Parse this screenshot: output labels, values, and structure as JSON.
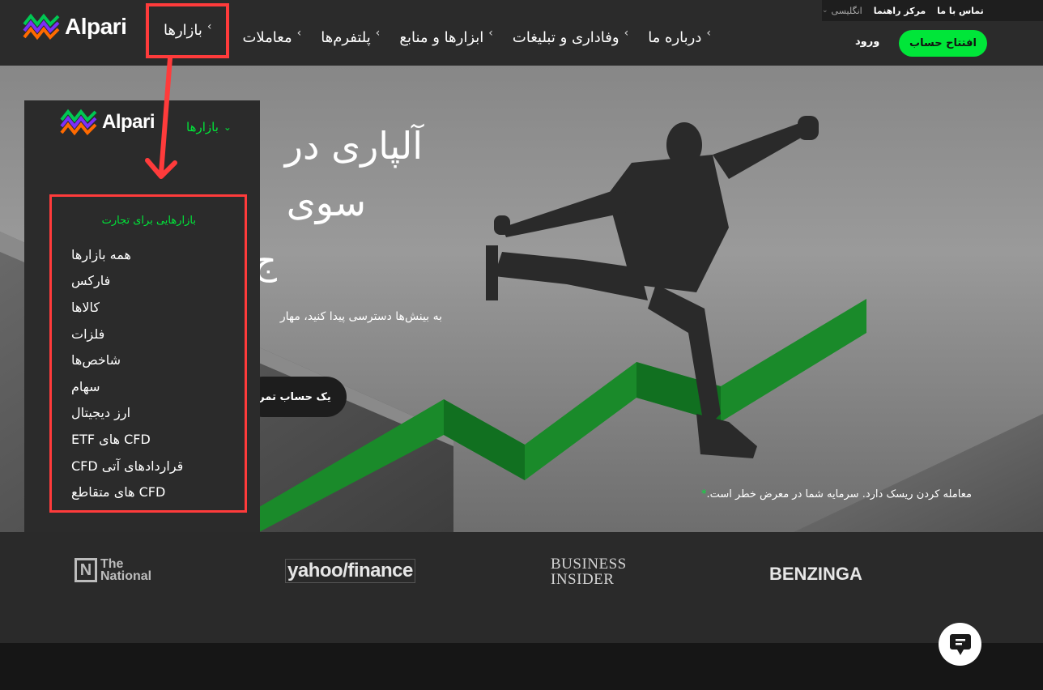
{
  "brand": {
    "name": "Alpari"
  },
  "utility": {
    "contact": "تماس با ما",
    "help_center": "مرکز راهنما",
    "language": "انگلیسی"
  },
  "nav": {
    "items": [
      {
        "label": "درباره ما"
      },
      {
        "label": "وفاداری و تبلیغات"
      },
      {
        "label": "ابزارها و منابع"
      },
      {
        "label": "پلتفرم‌ها"
      },
      {
        "label": "معاملات"
      },
      {
        "label": "بازارها"
      }
    ]
  },
  "header": {
    "login": "ورود",
    "open_account": "افتتاح حساب"
  },
  "hero": {
    "title_line1": "آلپاری در",
    "title_line2": "سوی",
    "title_line3": "ج",
    "subtitle": "به بینش‌ها دسترسی پیدا کنید، مهار",
    "demo_button": "یک حساب تمر",
    "risk_warning": "معامله کردن ریسک دارد. سرمایه شما در معرض خطر است.",
    "risk_star": "*"
  },
  "dropdown": {
    "toggle_label": "بازارها",
    "heading": "بازارهایی برای تجارت",
    "items": [
      "همه بازارها",
      "فارکس",
      "کالاها",
      "فلزات",
      "شاخص‌ها",
      "سهام",
      "ارز دیجیتال",
      "CFD های ETF",
      "قراردادهای آتی CFD",
      "CFD های متقاطع"
    ]
  },
  "press": {
    "national_mark": "N",
    "national_line1": "The",
    "national_line2": "National",
    "yahoo": "yahoo/finance",
    "business_line1": "BUSINESS",
    "business_line2": "INSIDER",
    "benzinga": "BENZINGA"
  },
  "colors": {
    "accent_green": "#00e639",
    "annotation_red": "#ff3b3b",
    "header_bg": "#2b2b2b"
  }
}
